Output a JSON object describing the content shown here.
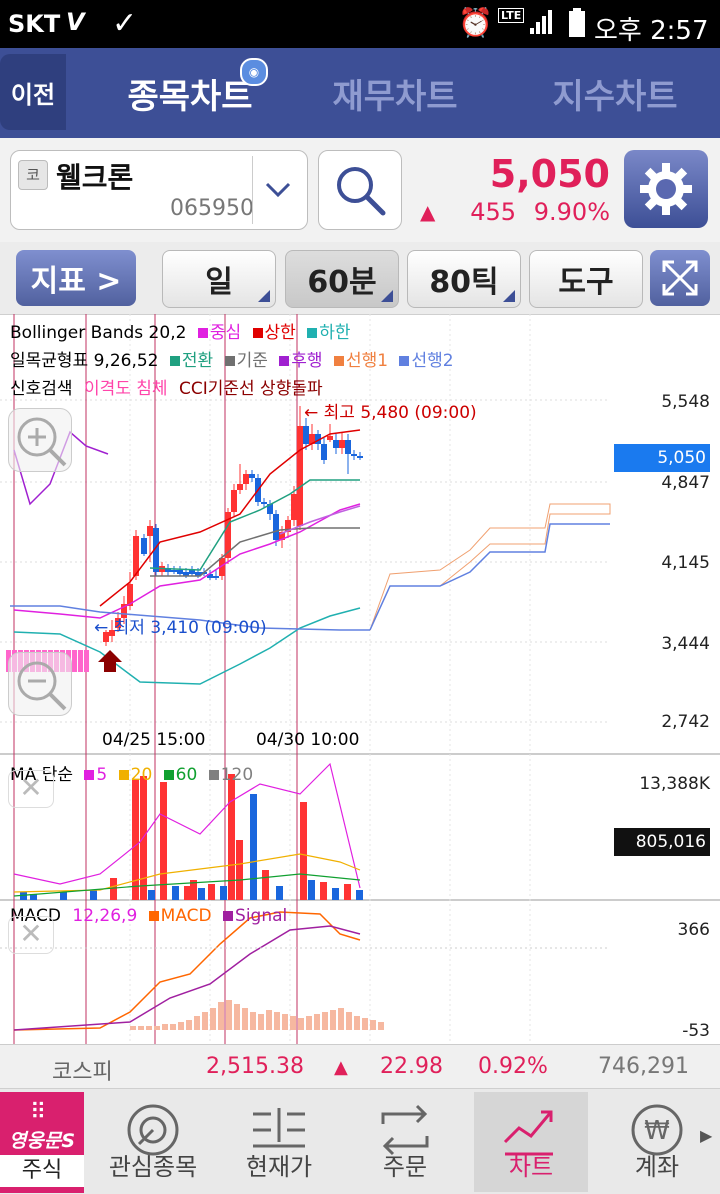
{
  "status_bar": {
    "carrier": "SKT",
    "network": "LTE",
    "time": "오후 2:57"
  },
  "nav": {
    "back": "이전",
    "tabs": [
      "종목차트",
      "재무차트",
      "지수차트"
    ],
    "active": 0
  },
  "stock": {
    "market_badge": "코",
    "name": "웰크론",
    "code": "065950",
    "price": "5,050",
    "change": "455",
    "change_pct": "9.90%",
    "direction": "up"
  },
  "toolbar": {
    "indicator": "지표 >",
    "period_day": "일",
    "period_min": "60분",
    "period_tick": "80틱",
    "tools": "도구"
  },
  "main_chart": {
    "legend1": {
      "name": "Bollinger Bands 20,2",
      "items": [
        "중심",
        "상한",
        "하한"
      ],
      "colors": [
        "#e020e0",
        "#e00000",
        "#20b0b0"
      ]
    },
    "legend2": {
      "name": "일목균형표 9,26,52",
      "items": [
        "전환",
        "기준",
        "후행",
        "선행1",
        "선행2"
      ],
      "colors": [
        "#20a080",
        "#707070",
        "#a020d0",
        "#f08040",
        "#6080e0"
      ]
    },
    "legend3": {
      "name": "신호검색",
      "signal1": "이격도 침체",
      "signal2": "CCI기준선 상향돌파"
    },
    "high_label": "← 최고 5,480 (09:00)",
    "low_label": "← 최저 3,410 (09:00)",
    "y_ticks": [
      "5,548",
      "4,847",
      "4,145",
      "3,444",
      "2,742"
    ],
    "current_price_tag": "5,050",
    "x_ticks": [
      "04/25 15:00",
      "04/30 10:00"
    ]
  },
  "volume_chart": {
    "legend_name": "MA 단순",
    "items": [
      "5",
      "20",
      "60",
      "120"
    ],
    "colors": [
      "#e020e0",
      "#f0b000",
      "#10a030",
      "#808080"
    ],
    "y_top": "13,388K",
    "current_tag": "805,016"
  },
  "macd_chart": {
    "name": "MACD",
    "params": "12,26,9",
    "items": [
      "MACD",
      "Signal"
    ],
    "colors": [
      "#ff6600",
      "#a020a0"
    ],
    "y_top": "366",
    "y_bottom": "-53"
  },
  "chart_data": {
    "type": "candlestick",
    "title": "",
    "high": 5480,
    "low": 3410,
    "ylim": [
      2742,
      5548
    ],
    "last_price": 5050
  },
  "index_bar": {
    "name": "코스피",
    "value": "2,515.38",
    "change": "22.98",
    "change_pct": "0.92%",
    "volume": "746,291"
  },
  "bottom_nav": {
    "brand": "영웅문S",
    "items": [
      "주식",
      "관심종목",
      "현재가",
      "주문",
      "차트",
      "계좌"
    ],
    "active": 4
  },
  "colors": {
    "up": "#e0205a",
    "nav_bg": "#3d4f96",
    "candle_up": "#ff3333",
    "candle_down": "#1a66dd",
    "price_tag": "#1a7aef"
  }
}
